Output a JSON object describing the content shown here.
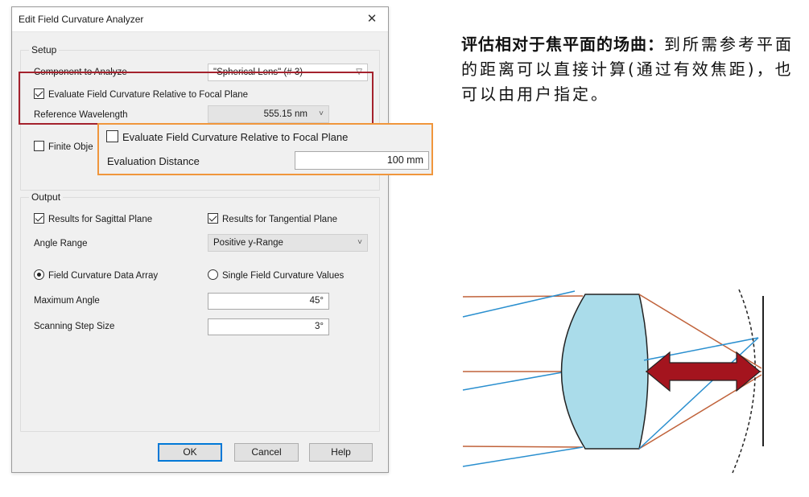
{
  "dialog": {
    "title": "Edit Field Curvature Analyzer",
    "close_glyph": "✕"
  },
  "setup": {
    "group_label": "Setup",
    "component_label": "Component to Analyze",
    "component_value": "\"Spherical Lens\" (# 3)",
    "evaluate_label": "Evaluate Field Curvature Relative to Focal Plane",
    "evaluate_checked": true,
    "ref_wavelength_label": "Reference Wavelength",
    "ref_wavelength_value": "555.15 nm",
    "finite_label": "Finite Obje"
  },
  "zoom": {
    "evaluate_label": "Evaluate Field Curvature Relative to Focal Plane",
    "evaluate_checked": false,
    "distance_label": "Evaluation Distance",
    "distance_value": "100 mm"
  },
  "output": {
    "group_label": "Output",
    "sagittal_label": "Results for Sagittal Plane",
    "tangential_label": "Results for Tangential Plane",
    "angle_range_label": "Angle Range",
    "angle_range_value": "Positive y-Range",
    "data_array_label": "Field Curvature Data Array",
    "single_values_label": "Single Field Curvature Values",
    "max_angle_label": "Maximum Angle",
    "max_angle_value": "45°",
    "step_label": "Scanning Step Size",
    "step_value": "3°"
  },
  "buttons": {
    "ok": "OK",
    "cancel": "Cancel",
    "help": "Help"
  },
  "description": {
    "heading": "评估相对于焦平面的场曲：",
    "body": "到所需参考平面的距离可以直接计算(通过有效焦距)，也可以由用户指定。"
  },
  "colors": {
    "highlight_red": "#a4222d",
    "highlight_orange": "#f0963c",
    "lens_fill": "#aadcea",
    "ray_orange": "#c0623a",
    "ray_blue": "#2a8fcf",
    "arrow_red": "#a4141e"
  }
}
